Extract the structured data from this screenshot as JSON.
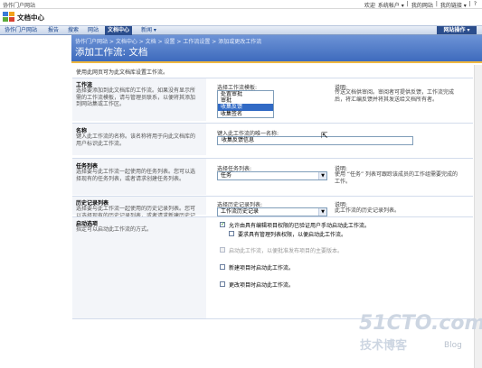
{
  "topbar": {
    "site_link": "协作门户网站",
    "links": [
      "欢迎",
      "系统帐户 ▾",
      "|",
      "我的网站",
      "|",
      "我的链接 ▾",
      "|",
      "?"
    ]
  },
  "site": {
    "name": "文档中心"
  },
  "nav": {
    "tabs": [
      "协作门户网站",
      "报告",
      "搜索",
      "网站",
      "文档中心",
      "新闻 ▾"
    ],
    "active_tab": "文档中心",
    "site_actions": "网站操作 ▾"
  },
  "header": {
    "breadcrumb": "协作门户网站 > 文档中心 > 文档 > 设置 > 工作流设置 > 添加或更改工作流",
    "title": "添加工作流: 文档"
  },
  "intro": "使用此网页可为此文档库设置工作流。",
  "sections": {
    "workflow": {
      "title": "工作流",
      "desc": "选择要添加到此文档库的工作流。如果没有显示所需的工作流模板，请与管理员联系，以便将其添加到网站集或工作区。",
      "field_label": "选择工作流模板:",
      "options": [
        "处置审批",
        "审批",
        "收集反馈",
        "收集签名"
      ],
      "selected": "收集反馈",
      "desc_label": "说明:",
      "desc_text": "传送文档供审阅。审阅者可提供反馈，工作流完成后，将汇编反馈并将其发送给文档所有者。"
    },
    "name": {
      "title": "名称",
      "desc": "键入此工作流的名称。该名称将用于向此文档库的用户标识此工作流。",
      "field_label": "键入此工作流的唯一名称:",
      "value": "收集反馈信息"
    },
    "tasklist": {
      "title": "任务列表",
      "desc": "选择要与此工作流一起使用的任务列表。您可以选择现有的任务列表，或者请求创建任务列表。",
      "field_label": "选择任务列表:",
      "value": "任务",
      "desc_label": "说明:",
      "desc_text": "使用 “任务” 列表可跟踪该成员的工作组需要完成的工作。"
    },
    "history": {
      "title": "历史记录列表",
      "desc": "选择要与此工作流一起使用的历史记录列表。您可以选择现有的历史记录列表，或者请求新建历史记录列表。",
      "field_label": "选择历史记录列表:",
      "value": "工作流历史记录",
      "desc_label": "说明:",
      "desc_text": "此工作流的历史记录列表。"
    },
    "start": {
      "title": "启动选项",
      "desc": "指定可以启动此工作流的方式。",
      "opt1": "允许由具有编辑项目权限的已验证用户手动启动此工作流。",
      "opt1_sub": "要求具有管理列表权限，以便启动此工作流。",
      "opt2": "启动此工作流，以便批准发布项目的主要版本。",
      "opt3": "新建项目时启动此工作流。",
      "opt4": "更改项目时启动此工作流。"
    }
  },
  "watermark": {
    "line1": "51CTO.com",
    "line2": "技术博客",
    "line3": "Blog"
  }
}
